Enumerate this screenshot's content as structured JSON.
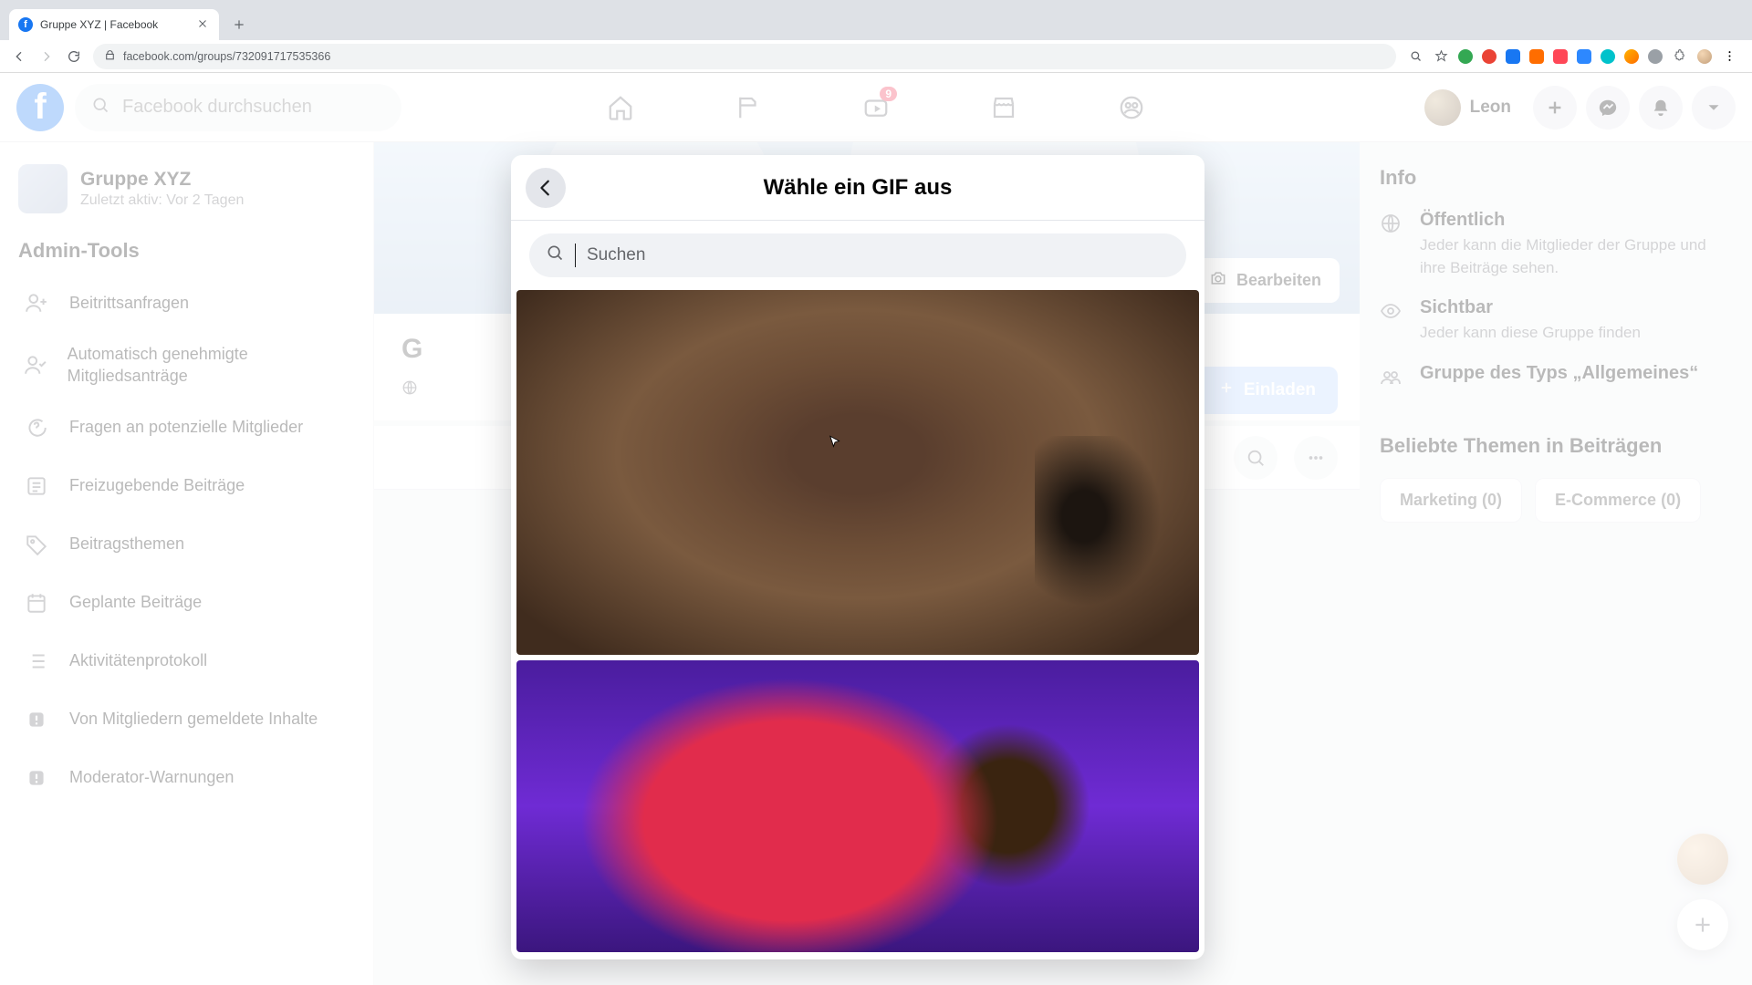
{
  "browser": {
    "tab_title": "Gruppe XYZ | Facebook",
    "url": "facebook.com/groups/732091717535366"
  },
  "fb": {
    "search_placeholder": "Facebook durchsuchen",
    "watch_badge": "9",
    "profile_name": "Leon"
  },
  "group": {
    "name": "Gruppe XYZ",
    "last_active": "Zuletzt aktiv: Vor 2 Tagen"
  },
  "admin": {
    "title": "Admin-Tools",
    "items": [
      "Beitrittsanfragen",
      "Automatisch genehmigte Mitgliedsanträge",
      "Fragen an potenzielle Mitglieder",
      "Freizugebende Beiträge",
      "Beitragsthemen",
      "Geplante Beiträge",
      "Aktivitätenprotokoll",
      "Von Mitgliedern gemeldete Inhalte",
      "Moderator-Warnungen"
    ]
  },
  "cover": {
    "edit": "Bearbeiten"
  },
  "header_row": {
    "initial": "G",
    "invite": "Einladen"
  },
  "info": {
    "title": "Info",
    "vis_head": "Öffentlich",
    "vis_body": "Jeder kann die Mitglieder der Gruppe und ihre Beiträge sehen.",
    "find_head": "Sichtbar",
    "find_body": "Jeder kann diese Gruppe finden",
    "type": "Gruppe des Typs „Allgemeines“"
  },
  "topics": {
    "title": "Beliebte Themen in Beiträgen",
    "items": [
      "Marketing (0)",
      "E-Commerce (0)"
    ]
  },
  "modal": {
    "title": "Wähle ein GIF aus",
    "search_placeholder": "Suchen"
  }
}
